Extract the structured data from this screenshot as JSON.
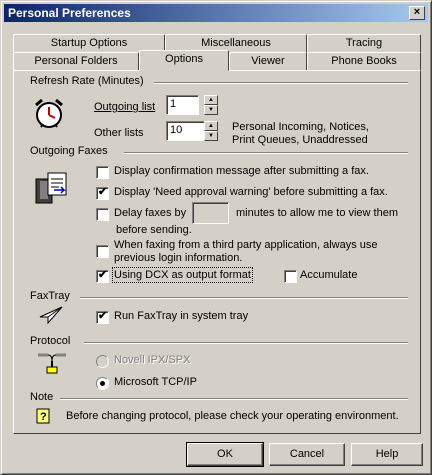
{
  "window": {
    "title": "Personal Preferences",
    "close_glyph": "×"
  },
  "tabs": {
    "row_back": [
      "Startup Options",
      "Miscellaneous",
      "Tracing"
    ],
    "row_front": [
      "Personal Folders",
      "Options",
      "Viewer",
      "Phone Books"
    ],
    "active": "Options"
  },
  "refresh": {
    "label": "Refresh Rate (Minutes)",
    "outgoing_label": "Outgoing list",
    "outgoing_value": "1",
    "other_label": "Other lists",
    "other_value": "10",
    "other_note_line1": "Personal Incoming,  Notices,",
    "other_note_line2": "Print Queues, Unaddressed"
  },
  "outgoing_faxes": {
    "label": "Outgoing Faxes",
    "confirm": "Display confirmation message after submitting a fax.",
    "approval": "Display 'Need approval warning' before submitting a fax.",
    "delay_prefix": "Delay faxes by",
    "delay_value": "",
    "delay_suffix": "minutes to allow me to view them",
    "delay_line2": "before sending.",
    "third_party_line1": "When faxing from a third party application, always use",
    "third_party_line2": "previous login information.",
    "dcx": "Using DCX as output format",
    "accumulate": "Accumulate",
    "checked": {
      "confirm": false,
      "approval": true,
      "delay": false,
      "third_party": false,
      "dcx": true,
      "accumulate": false
    }
  },
  "faxtray": {
    "label": "FaxTray",
    "run": "Run FaxTray in system tray",
    "checked": true
  },
  "protocol": {
    "label": "Protocol",
    "novell": "Novell IPX/SPX",
    "tcpip": "Microsoft TCP/IP",
    "selected": "tcpip"
  },
  "note": {
    "label": "Note",
    "text": "Before changing protocol, please check your operating environment."
  },
  "buttons": {
    "ok": "OK",
    "cancel": "Cancel",
    "help": "Help"
  },
  "check_glyph": "✔"
}
